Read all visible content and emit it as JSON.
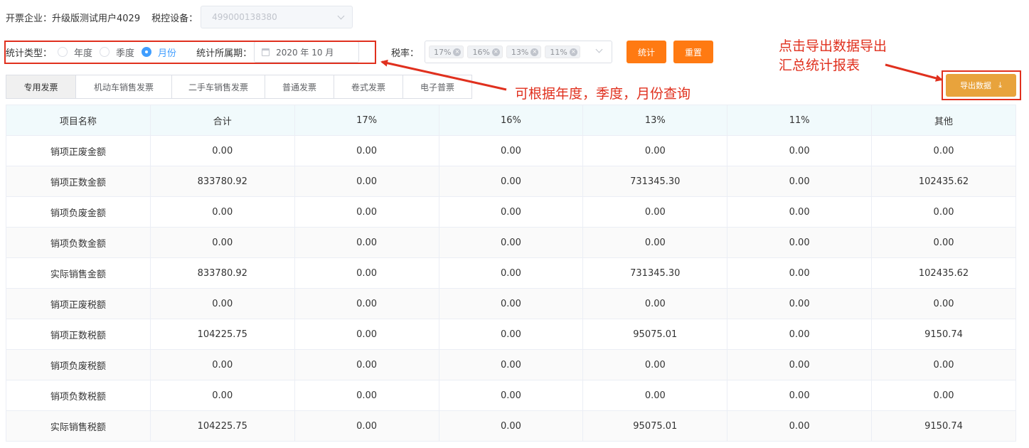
{
  "header": {
    "company": "开票企业：升级版测试用户4029",
    "device_label": "税控设备：",
    "device_value": "499000138380"
  },
  "filters": {
    "type_label": "统计类型：",
    "types": [
      "年度",
      "季度",
      "月份"
    ],
    "selected_type": "月份",
    "period_label": "统计所属期：",
    "period_value": "2020 年 10 月",
    "rate_label": "税率：",
    "rates": [
      "17%",
      "16%",
      "13%",
      "11%"
    ],
    "stat_button": "统计",
    "reset_button": "重置",
    "export_button": "导出数据"
  },
  "tabs": [
    "专用发票",
    "机动车销售发票",
    "二手车销售发票",
    "普通发票",
    "卷式发票",
    "电子普票"
  ],
  "active_tab": "专用发票",
  "annotations": {
    "query_note": "可根据年度，季度，月份查询",
    "export_note_line1": "点击导出数据导出",
    "export_note_line2": "汇总统计报表"
  },
  "table": {
    "headers": [
      "项目名称",
      "合计",
      "17%",
      "16%",
      "13%",
      "11%",
      "其他"
    ],
    "rows": [
      [
        "销项正废金额",
        "0.00",
        "0.00",
        "0.00",
        "0.00",
        "0.00",
        "0.00"
      ],
      [
        "销项正数金额",
        "833780.92",
        "0.00",
        "0.00",
        "731345.30",
        "0.00",
        "102435.62"
      ],
      [
        "销项负废金额",
        "0.00",
        "0.00",
        "0.00",
        "0.00",
        "0.00",
        "0.00"
      ],
      [
        "销项负数金额",
        "0.00",
        "0.00",
        "0.00",
        "0.00",
        "0.00",
        "0.00"
      ],
      [
        "实际销售金额",
        "833780.92",
        "0.00",
        "0.00",
        "731345.30",
        "0.00",
        "102435.62"
      ],
      [
        "销项正废税额",
        "0.00",
        "0.00",
        "0.00",
        "0.00",
        "0.00",
        "0.00"
      ],
      [
        "销项正数税额",
        "104225.75",
        "0.00",
        "0.00",
        "95075.01",
        "0.00",
        "9150.74"
      ],
      [
        "销项负废税额",
        "0.00",
        "0.00",
        "0.00",
        "0.00",
        "0.00",
        "0.00"
      ],
      [
        "销项负数税额",
        "0.00",
        "0.00",
        "0.00",
        "0.00",
        "0.00",
        "0.00"
      ],
      [
        "实际销售税额",
        "104225.75",
        "0.00",
        "0.00",
        "95075.01",
        "0.00",
        "9150.74"
      ]
    ]
  },
  "colors": {
    "accent_orange": "#ff7a12",
    "export_orange": "#e8a33c",
    "annotation_red": "#e0301e",
    "radio_blue": "#409eff"
  }
}
